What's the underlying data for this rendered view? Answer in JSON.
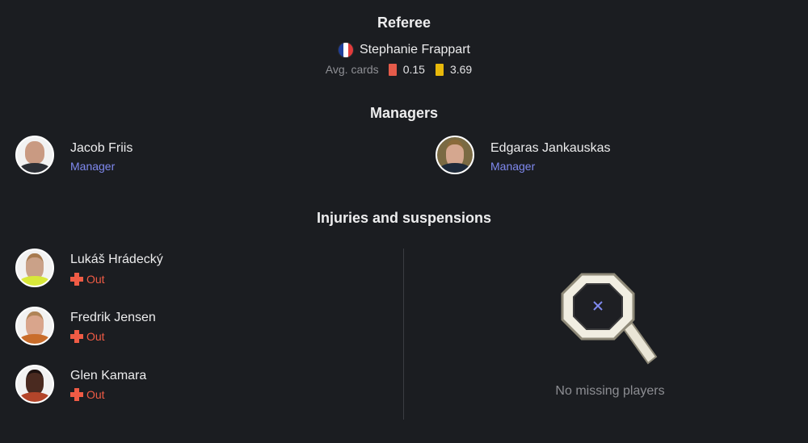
{
  "referee": {
    "section_title": "Referee",
    "name": "Stephanie Frappart",
    "flag_icon": "france-flag-icon",
    "flag_colors": [
      "#1f3f9b",
      "#ffffff",
      "#e23b3b"
    ],
    "avg_cards_label": "Avg. cards",
    "red_avg": "0.15",
    "yellow_avg": "3.69"
  },
  "managers": {
    "section_title": "Managers",
    "home": {
      "name": "Jacob Friis",
      "role": "Manager"
    },
    "away": {
      "name": "Edgaras Jankauskas",
      "role": "Manager"
    }
  },
  "injuries": {
    "section_title": "Injuries and suspensions",
    "home": [
      {
        "name": "Lukáš Hrádecký",
        "status": "Out"
      },
      {
        "name": "Fredrik Jensen",
        "status": "Out"
      },
      {
        "name": "Glen Kamara",
        "status": "Out"
      }
    ],
    "away_empty_text": "No missing players"
  },
  "colors": {
    "background": "#1b1d21",
    "accent": "#7f89ef",
    "out": "#ef5b45",
    "red_card": "#e55b4a",
    "yellow_card": "#e8b90b"
  }
}
